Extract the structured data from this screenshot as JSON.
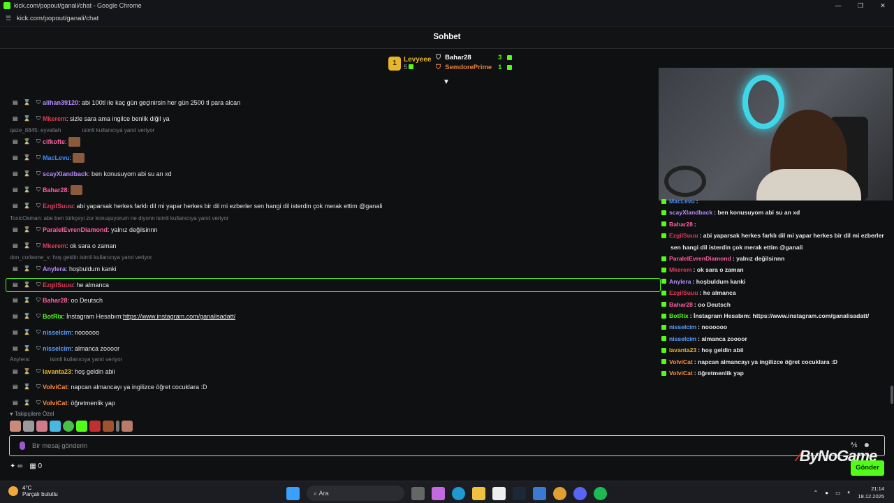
{
  "window": {
    "title": "kick.com/popout/ganali/chat - Google Chrome",
    "url": "kick.com/popout/ganali/chat"
  },
  "header": {
    "title": "Sohbet"
  },
  "leaderboard": {
    "first": {
      "rank": "1",
      "name": "Levyeee",
      "count": "5"
    },
    "second": {
      "name": "Bahar28",
      "count": "3"
    },
    "third": {
      "name": "SemdorePrime",
      "count": "1"
    }
  },
  "chat": {
    "messages": [
      {
        "user": "alihan39120",
        "color": "#b48cff",
        "text": ": abi 100tl ile kaç gün geçinirsin her gün 2500 tl para alcan"
      },
      {
        "user": "Mkerem",
        "color": "#e03a5c",
        "text": ": sizle sara ama ingilce benlik diğil ya"
      },
      {
        "reply": "qaze_8845: eyvallah",
        "reply_suffix": "isimli kullanıcıya yanıt veriyor"
      },
      {
        "user": "cifkofte",
        "color": "#ff5fa0",
        "text": ":"
      },
      {
        "user": "MacLevu",
        "color": "#3f8cff",
        "text": ":"
      },
      {
        "user": "scayXlandback",
        "color": "#b48cff",
        "text": ": ben konusuyom abi su an xd"
      },
      {
        "user": "Bahar28",
        "color": "#ff5fa0",
        "text": ":"
      },
      {
        "user": "EzgilSuuu",
        "color": "#e03a5c",
        "text": ": abi yaparsak herkes farklı dil mi yapar herkes bir dil mi ezberler sen hangi dil isterdin çok merak ettim @ganali"
      },
      {
        "reply": "ToxicOsman: abe ben türkçeyi zor konuşuyorum ne diyonn isimli kullanıcıya yanıt veriyor"
      },
      {
        "user": "ParalelEvrenDiamond",
        "color": "#ff5fa0",
        "text": ": yalnız değilsinnn"
      },
      {
        "user": "Mkerem",
        "color": "#e03a5c",
        "text": ": ok sara o zaman"
      },
      {
        "reply": "don_corleone_v: hoş geldin isimli kullanıcıya yanıt veriyor"
      },
      {
        "user": "Anylera",
        "color": "#b48cff",
        "text": ": hoşbuldum kanki"
      },
      {
        "user": "EzgilSuuu",
        "color": "#e03a5c",
        "text": ": he almanca"
      },
      {
        "user": "Bahar28",
        "color": "#ff5fa0",
        "text": ": oo Deutsch"
      },
      {
        "user": "BotRix",
        "color": "#53fc18",
        "text": ": İnstagram Hesabım: ",
        "link": "https://www.instagram.com/ganalisadatt/"
      },
      {
        "user": "nisselcim",
        "color": "#5aa0ff",
        "text": ": noooooo"
      },
      {
        "user": "nisselcim",
        "color": "#5aa0ff",
        "text": ": almanca zoooor"
      },
      {
        "reply": "Anylera:",
        "reply_suffix": "isimli kullanıcıya yanıt veriyor"
      },
      {
        "user": "lavanta23",
        "color": "#e8b62a",
        "text": ": hoş geldin abii"
      },
      {
        "user": "VolviCat",
        "color": "#ff8c3a",
        "text": ": napcan almancayı ya ingilizce öğret cocuklara :D"
      },
      {
        "user": "VolviCat",
        "color": "#ff8c3a",
        "text": ": öğretmenlik yap"
      }
    ]
  },
  "favorites_label": "Takipçilere Özel",
  "input": {
    "placeholder": "Bir mesaj gönderin"
  },
  "bottom": {
    "count": "0",
    "send_label": "Gönder"
  },
  "watermark": "ByNoGame",
  "overlay_chat": [
    {
      "user": "MacLevu",
      "color": "#3f8cff",
      "text": ":"
    },
    {
      "user": "scayXlandback",
      "color": "#b48cff",
      "text": ": ben konusuyom abi su an xd"
    },
    {
      "user": "Bahar28",
      "color": "#ff5fa0",
      "text": ":"
    },
    {
      "user": "EzgilSuuu",
      "color": "#e03a5c",
      "text": ": abi yaparsak herkes farklı dil mi yapar herkes bir dil mi ezberler"
    },
    {
      "user": "",
      "color": "#e8e8e8",
      "text": "sen hangi dil isterdin çok merak ettim @ganali"
    },
    {
      "user": "ParalelEvrenDiamond",
      "color": "#ff5fa0",
      "text": ": yalnız değilsinnn"
    },
    {
      "user": "Mkerem",
      "color": "#e03a5c",
      "text": ": ok sara o zaman"
    },
    {
      "user": "Anylera",
      "color": "#b48cff",
      "text": ": hoşbuldum kanki"
    },
    {
      "user": "EzgilSuuu",
      "color": "#e03a5c",
      "text": ": he almanca"
    },
    {
      "user": "Bahar28",
      "color": "#ff5fa0",
      "text": ": oo Deutsch"
    },
    {
      "user": "BotRix",
      "color": "#53fc18",
      "text": ": İnstagram Hesabım: https://www.instagram.com/ganalisadatt/"
    },
    {
      "user": "nisselcim",
      "color": "#5aa0ff",
      "text": ": noooooo"
    },
    {
      "user": "nisselcim",
      "color": "#5aa0ff",
      "text": ": almanca zoooor"
    },
    {
      "user": "lavanta23",
      "color": "#e8b62a",
      "text": ": hoş geldin abii"
    },
    {
      "user": "VolviCat",
      "color": "#ff8c3a",
      "text": ": napcan almancayı ya ingilizce öğret cocuklara :D"
    },
    {
      "user": "VolviCat",
      "color": "#ff8c3a",
      "text": ": öğretmenlik yap"
    }
  ],
  "taskbar": {
    "weather_temp": "4°C",
    "weather_desc": "Parçalı bulutlu",
    "search": "Ara",
    "time": "21:14",
    "date": "18.12.2025"
  }
}
